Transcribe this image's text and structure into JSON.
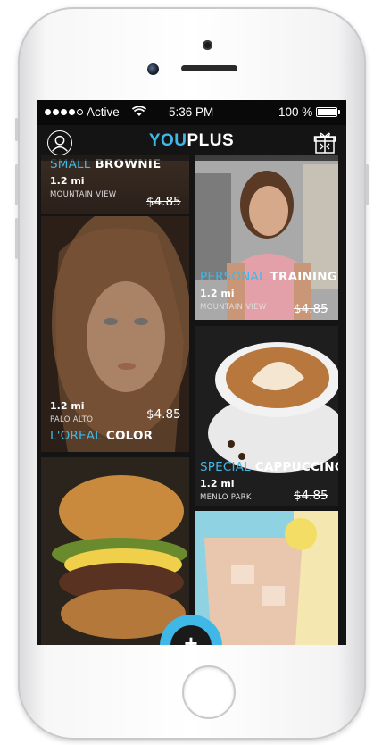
{
  "status": {
    "carrier": "Active",
    "time": "5:36 PM",
    "battery": "100 %",
    "signal_bars": 4
  },
  "nav": {
    "logo_you": "YOU",
    "logo_plus": "PLUS",
    "profile_icon": "user-icon",
    "gift_icon": "gift-icon"
  },
  "deals": [
    {
      "title_highlight": "SMALL",
      "title_rest": " BROWNIE",
      "distance": "1.2 mi",
      "location": "MOUNTAIN VIEW",
      "price": "$4.85"
    },
    {
      "title_highlight": "PERSONAL",
      "title_rest": " TRAINING",
      "distance": "1.2 mi",
      "location": "MOUNTAIN VIEW",
      "price": "$4.85"
    },
    {
      "title_highlight": "L'OREAL",
      "title_rest": " COLOR",
      "distance": "1.2 mi",
      "location": "PALO ALTO",
      "price": "$4.85"
    },
    {
      "title_highlight": "SPECIAL",
      "title_rest": " CAPPUCCINO",
      "distance": "1.2 mi",
      "location": "MENLO PARK",
      "price": "$4.85"
    }
  ],
  "fab": {
    "label": "+"
  },
  "colors": {
    "accent": "#3fb8e8",
    "screen_bg": "#141414"
  }
}
